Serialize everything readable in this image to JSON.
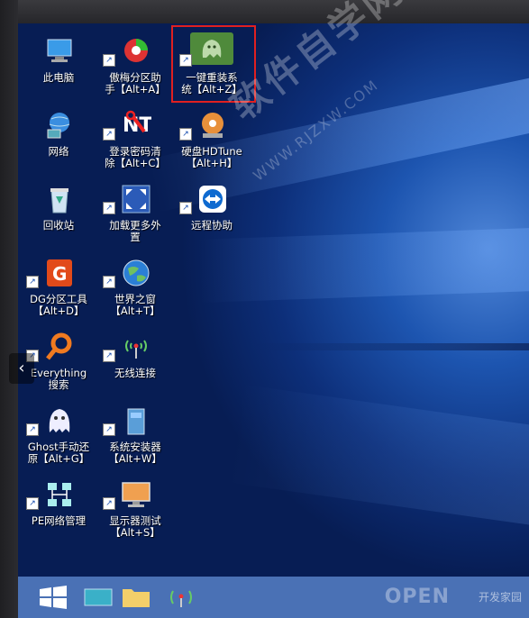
{
  "desktop": {
    "icons": [
      {
        "name": "computer-icon",
        "label1": "此电脑",
        "label2": ""
      },
      {
        "name": "partition-assistant-icon",
        "label1": "傲梅分区助",
        "label2": "手【Alt+A】"
      },
      {
        "name": "ghost-reinstall-icon",
        "label1": "一键重装系",
        "label2": "统【Alt+Z】"
      },
      {
        "name": "network-icon",
        "label1": "网络",
        "label2": ""
      },
      {
        "name": "password-clear-icon",
        "label1": "登录密码清",
        "label2": "除【Alt+C】"
      },
      {
        "name": "hdtune-icon",
        "label1": "硬盘HDTune",
        "label2": "【Alt+H】"
      },
      {
        "name": "recycle-bin-icon",
        "label1": "回收站",
        "label2": ""
      },
      {
        "name": "load-external-icon",
        "label1": "加载更多外",
        "label2": "置"
      },
      {
        "name": "teamviewer-icon",
        "label1": "远程协助",
        "label2": ""
      },
      {
        "name": "diskgenius-icon",
        "label1": "DG分区工具",
        "label2": "【Alt+D】"
      },
      {
        "name": "browser-globe-icon",
        "label1": "世界之窗",
        "label2": "【Alt+T】"
      },
      {
        "name": "everything-search-icon",
        "label1": "Everything",
        "label2": "搜索"
      },
      {
        "name": "wireless-icon",
        "label1": "无线连接",
        "label2": ""
      },
      {
        "name": "ghost-manual-icon",
        "label1": "Ghost手动还",
        "label2": "原【Alt+G】"
      },
      {
        "name": "system-installer-icon",
        "label1": "系统安装器",
        "label2": "【Alt+W】"
      },
      {
        "name": "pe-network-icon",
        "label1": "PE网络管理",
        "label2": ""
      },
      {
        "name": "monitor-test-icon",
        "label1": "显示器测试",
        "label2": "【Alt+S】"
      }
    ]
  },
  "watermark": {
    "text": "软件自学网",
    "sub": "WWW.RJZXW.COM"
  },
  "logo": {
    "main": "OPEN",
    "sub": "开发家园"
  },
  "nav": {
    "prev_arrow": "‹"
  }
}
